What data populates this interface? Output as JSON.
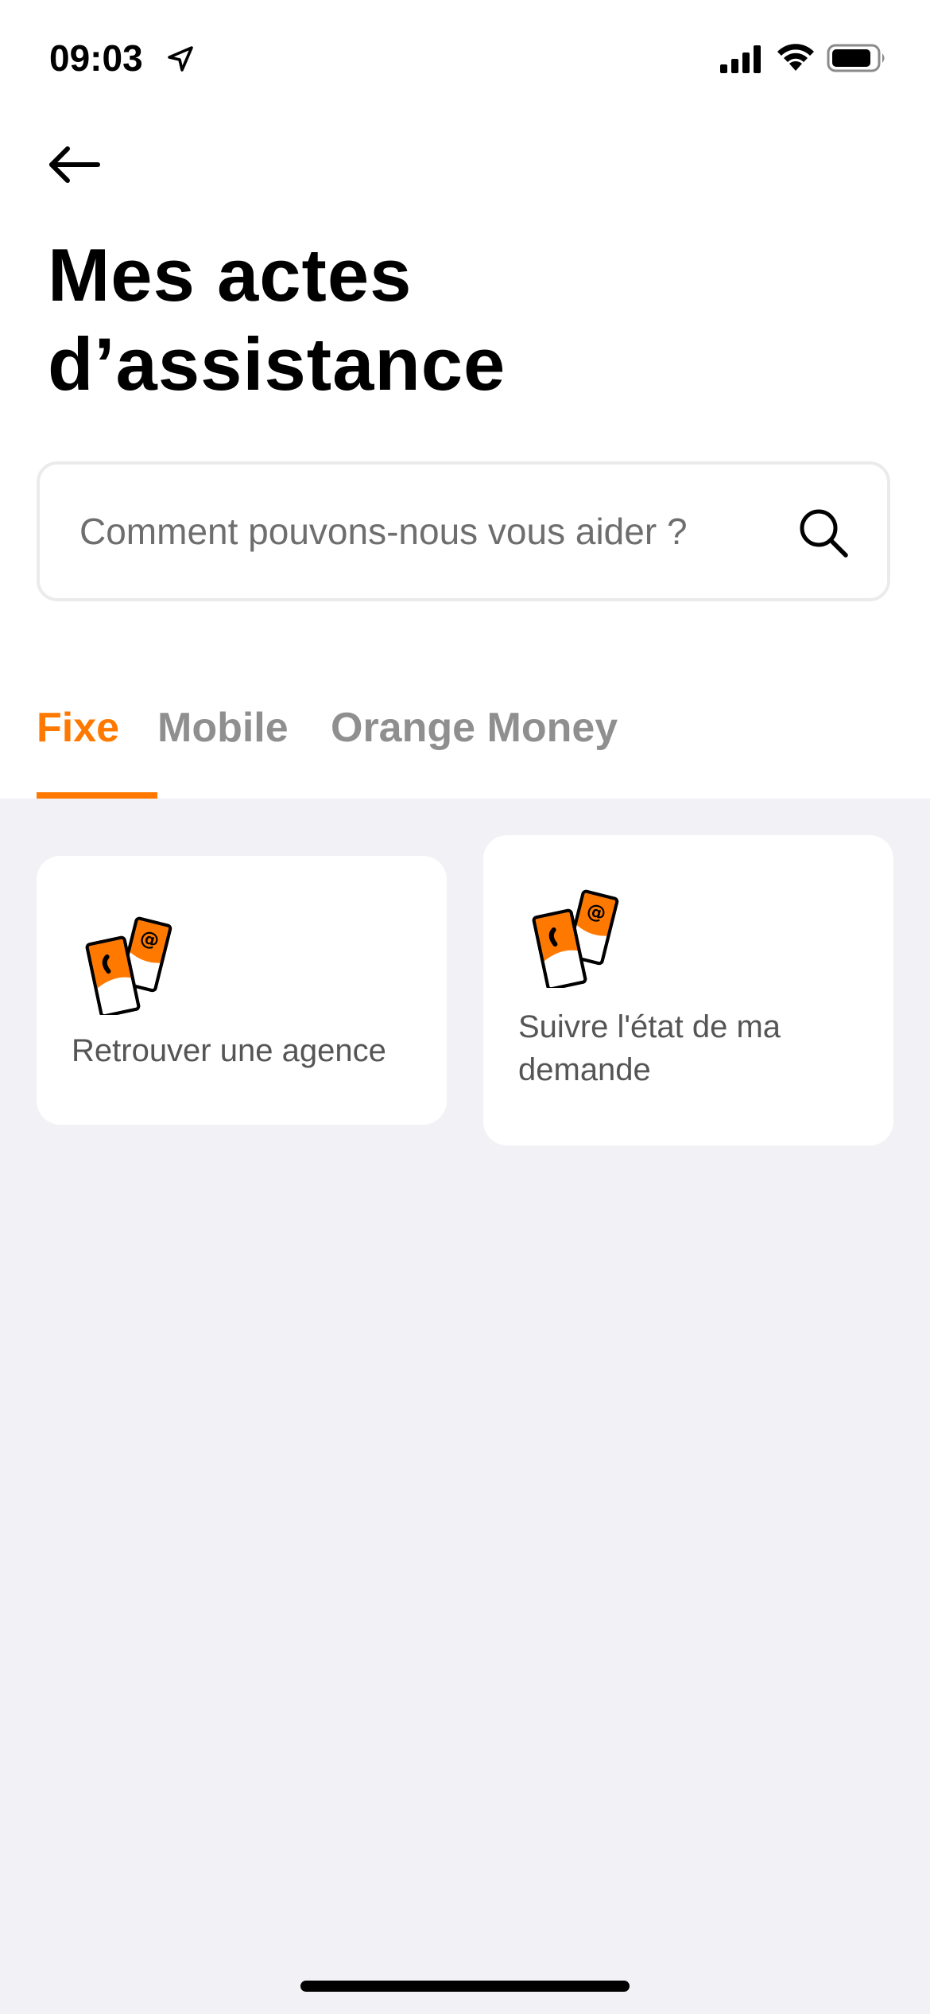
{
  "status_bar": {
    "time": "09:03",
    "location_icon": "location-arrow-icon",
    "signal_icon": "cellular-signal-icon",
    "wifi_icon": "wifi-icon",
    "battery_icon": "battery-icon"
  },
  "header": {
    "back_icon": "arrow-left-icon",
    "title": "Mes actes d’assistance"
  },
  "search": {
    "placeholder": "Comment pouvons-nous vous aider ?",
    "value": "",
    "icon": "search-icon"
  },
  "tabs": [
    {
      "label": "Fixe",
      "active": true
    },
    {
      "label": "Mobile",
      "active": false
    },
    {
      "label": "Orange Money",
      "active": false
    }
  ],
  "cards": [
    {
      "label": "Retrouver une agence",
      "icon": "phone-email-cards-icon"
    },
    {
      "label": "Suivre l'état de ma demande",
      "icon": "phone-email-cards-icon"
    }
  ],
  "colors": {
    "accent": "#ff7900",
    "background": "#f2f2f6",
    "surface": "#ffffff",
    "tab_inactive": "#8f8f8f",
    "text_secondary": "#555555"
  }
}
